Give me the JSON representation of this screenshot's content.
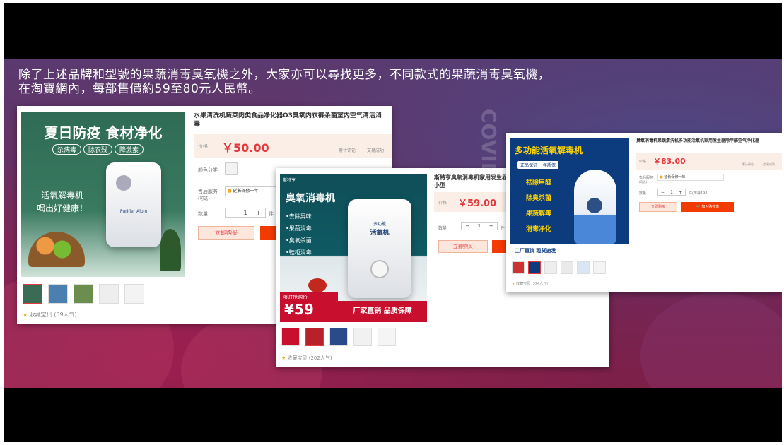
{
  "caption": {
    "line1": "除了上述品牌和型號的果蔬消毒臭氧機之外，大家亦可以尋找更多，不同款式的果蔬消毒臭氧機，",
    "line2": "在淘寶網內，每部售價約59至80元人民幣。"
  },
  "watermark": "COVID",
  "cards": [
    {
      "title": "水果清洗机蔬菜肉类食品净化器O3臭氧内衣裤杀菌室内空气清洁消毒",
      "price_label": "价格",
      "price": "￥50.00",
      "stat1": "累计评论",
      "stat2": "交易成功",
      "color_label": "颜色分类",
      "service_label": "售后服务",
      "service_sub": "(可选)",
      "service_value": "延长保修一年",
      "qty_label": "数量",
      "qty": "1",
      "unit": "件",
      "buy": "立即购买",
      "fav": "收藏宝贝 (59人气)",
      "banner_title": "夏日防疫 食材净化",
      "tags": [
        "杀病毒",
        "除农残",
        "降激素"
      ],
      "slogan1": "活氧解毒机",
      "slogan2": "喝出好健康！",
      "device_brand": "Purifier Alpin"
    },
    {
      "title": "斯特亨臭氧消毒机家用发生器小型",
      "price_label": "价格",
      "price": "￥59.00",
      "qty_label": "数量",
      "qty": "1",
      "unit": "件",
      "buy": "立即购买",
      "fav": "收藏宝贝 (202人气)",
      "brand": "斯特亨",
      "banner_title": "臭氧消毒机",
      "features": [
        "•去除异味",
        "•果蔬消毒",
        "•臭氧杀菌",
        "•鞋柜消毒"
      ],
      "device_label1": "多功能",
      "device_label2": "活氧机",
      "promo_label": "限时抢购价",
      "promo_price": "¥59",
      "promo_slogan": "厂家直销 品质保障"
    },
    {
      "title": "臭氧消毒机果蔬清洗机多功能活氧机家用发生器除甲醛空气净化器",
      "price_label": "价格",
      "price": "￥83.00",
      "stat1": "累计评论",
      "stat2": "交易成功",
      "service_label": "售后服务",
      "service_sub": "(可选)",
      "service_value": "延长保修一年",
      "qty_label": "数量",
      "qty": "1",
      "stock": "件(库存198)",
      "buy": "立即购买",
      "cart": "加入购物车",
      "fav": "收藏宝贝 (374人气)",
      "banner_title": "多功能活氧解毒机",
      "guarantee": "正品保证 一年质保",
      "features": [
        "祛除甲醛",
        "除臭杀菌",
        "果蔬解毒",
        "消毒净化"
      ],
      "footer": "工厂直销 现货速发"
    }
  ],
  "colors": {
    "price_red": "#e4393c",
    "cart_orange": "#f23b00",
    "banner_green": "#2f6b55",
    "banner_teal": "#0f4e58",
    "banner_blue": "#0c3b7e"
  }
}
